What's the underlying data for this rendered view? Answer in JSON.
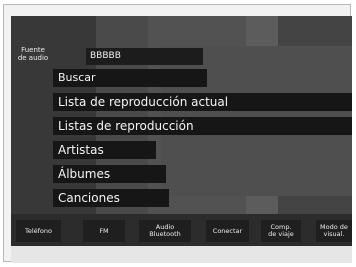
{
  "header": {
    "audio_source_label": "Fuente\nde audio",
    "source_name": "BBBBB"
  },
  "menu": {
    "items": [
      {
        "label": "Buscar"
      },
      {
        "label": "Lista de reproducción actual"
      },
      {
        "label": "Listas de reproducción"
      },
      {
        "label": "Artistas"
      },
      {
        "label": "Álbumes"
      },
      {
        "label": "Canciones"
      }
    ]
  },
  "bottom_bar": {
    "buttons": [
      {
        "label": "Teléfono"
      },
      {
        "label": "FM"
      },
      {
        "label": "Audio\nBluetooth"
      },
      {
        "label": "Conectar"
      },
      {
        "label": "Comp.\nde viaje"
      },
      {
        "label": "Modo de\nvisual."
      }
    ]
  }
}
